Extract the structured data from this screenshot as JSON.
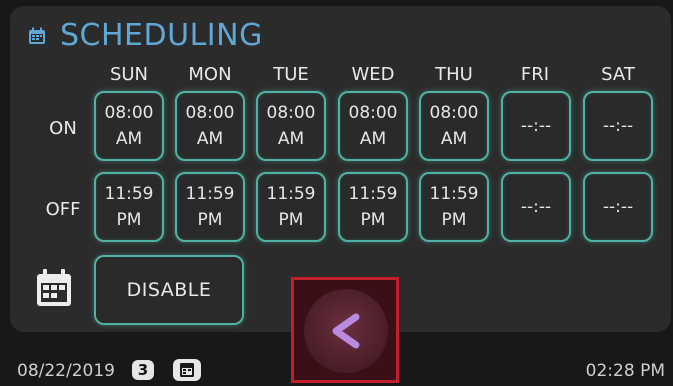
{
  "title": "SCHEDULING",
  "days": [
    "SUN",
    "MON",
    "TUE",
    "WED",
    "THU",
    "FRI",
    "SAT"
  ],
  "rows": {
    "on_label": "ON",
    "off_label": "OFF",
    "on": [
      {
        "time": "08:00",
        "period": "AM"
      },
      {
        "time": "08:00",
        "period": "AM"
      },
      {
        "time": "08:00",
        "period": "AM"
      },
      {
        "time": "08:00",
        "period": "AM"
      },
      {
        "time": "08:00",
        "period": "AM"
      },
      {
        "time": "--:--",
        "period": ""
      },
      {
        "time": "--:--",
        "period": ""
      }
    ],
    "off": [
      {
        "time": "11:59",
        "period": "PM"
      },
      {
        "time": "11:59",
        "period": "PM"
      },
      {
        "time": "11:59",
        "period": "PM"
      },
      {
        "time": "11:59",
        "period": "PM"
      },
      {
        "time": "11:59",
        "period": "PM"
      },
      {
        "time": "--:--",
        "period": ""
      },
      {
        "time": "--:--",
        "period": ""
      }
    ]
  },
  "disable_label": "DISABLE",
  "footer": {
    "date": "08/22/2019",
    "badge": "3",
    "time": "02:28 PM"
  },
  "colors": {
    "accent": "#5ea7d6",
    "slot_border": "#4fb2a5",
    "back_highlight": "#c41e2e",
    "back_arrow": "#b98be0"
  },
  "icons": {
    "title": "calendar-icon",
    "disable": "calendar-icon",
    "footer": "calendar-icon",
    "back": "chevron-left-icon"
  }
}
